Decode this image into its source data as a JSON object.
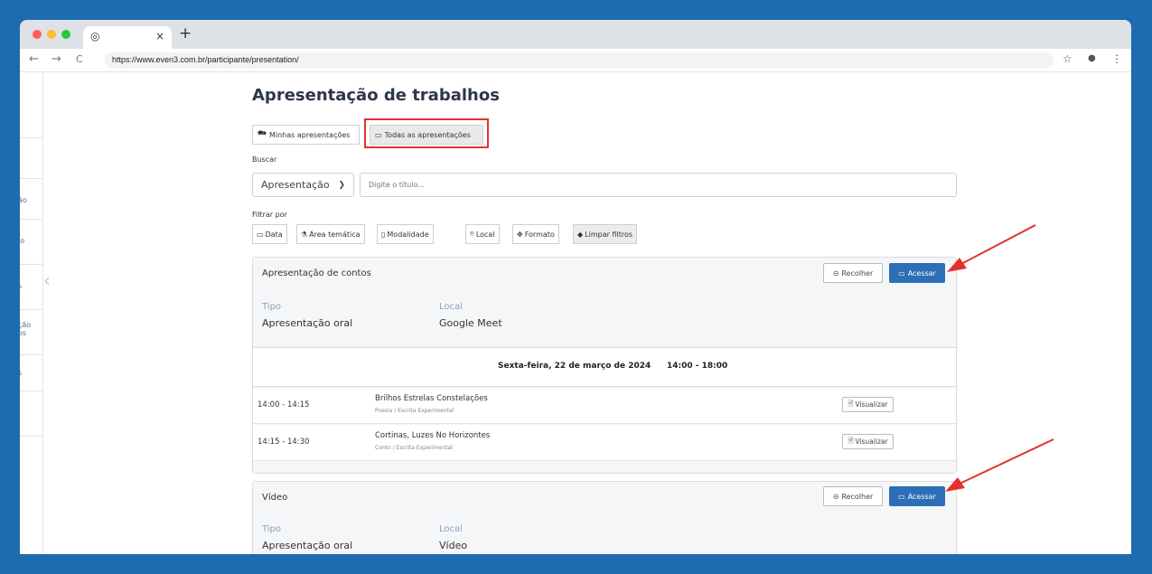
{
  "browser": {
    "url": "https://www.even3.com.br/participante/presentation/",
    "traffic_lights": [
      "#ff5f57",
      "#febc2e",
      "#28c840"
    ],
    "tab_close": "×",
    "new_tab": "+",
    "icons": {
      "back": "←",
      "forward": "→",
      "reload": "C",
      "bookmark": "☆",
      "profile": "●",
      "menu": "⋮",
      "chrome": "◎"
    }
  },
  "sidebar": {
    "items": [
      "ão",
      "io",
      "s",
      "ção\nos",
      "s"
    ],
    "collapse_icon": "‹"
  },
  "page": {
    "title": "Apresentação de trabalhos",
    "view_tabs": [
      {
        "label": "Minhas apresentações",
        "icon": "🗪"
      },
      {
        "label": "Todas as apresentações",
        "icon": "▭"
      }
    ],
    "search_label": "Buscar",
    "search_type": "Apresentação",
    "search_placeholder": "Digite o título...",
    "filter_label": "Filtrar por",
    "filters": [
      {
        "label": "Data",
        "icon": "▭"
      },
      {
        "label": "Área temática",
        "icon": "⚗"
      },
      {
        "label": "Modalidade",
        "icon": "▯"
      },
      {
        "label": "Local",
        "icon": "⌾"
      },
      {
        "label": "Formato",
        "icon": "✥"
      },
      {
        "label": "Limpar filtros",
        "icon": "◆"
      }
    ]
  },
  "sessions": [
    {
      "title": "Apresentação de contos",
      "collapse_label": "Recolher",
      "access_label": "Acessar",
      "tipo_label": "Tipo",
      "tipo": "Apresentação oral",
      "local_label": "Local",
      "local": "Google Meet",
      "day": "Sexta-feira, 22 de março de 2024",
      "hours": "14:00 - 18:00",
      "items": [
        {
          "time": "14:00 - 14:15",
          "title": "Brilhos Estrelas Constelações",
          "category": "Poesia / Escrita Experimental",
          "view_label": "Visualizar"
        },
        {
          "time": "14:15 - 14:30",
          "title": "Cortinas, Luzes No Horizontes",
          "category": "Conto / Escrita Experimental",
          "view_label": "Visualizar"
        }
      ]
    },
    {
      "title": "Vídeo",
      "collapse_label": "Recolher",
      "access_label": "Acessar",
      "tipo_label": "Tipo",
      "tipo": "Apresentação oral",
      "local_label": "Local",
      "local": "Vídeo"
    }
  ],
  "colors": {
    "accent": "#2c6fb6",
    "highlight": "#e3322d",
    "background": "#1e6bb0"
  }
}
